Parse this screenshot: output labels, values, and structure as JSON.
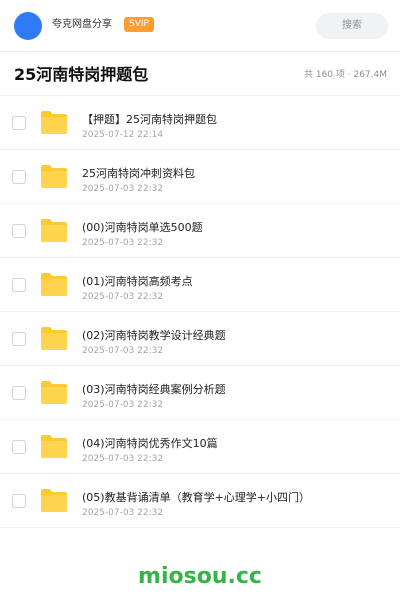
{
  "header": {
    "username": "夸克网盘分享",
    "badge": "SVIP",
    "search_label": "搜索"
  },
  "folder": {
    "title": "25河南特岗押题包",
    "meta": "共 160 项 · 267.4M"
  },
  "files": [
    {
      "name": "【押题】25河南特岗押题包",
      "date": "2025-07-12 22:14"
    },
    {
      "name": "25河南特岗冲刺资料包",
      "date": "2025-07-03 22:32"
    },
    {
      "name": "(00)河南特岗单选500题",
      "date": "2025-07-03 22:32"
    },
    {
      "name": "(01)河南特岗高频考点",
      "date": "2025-07-03 22:32"
    },
    {
      "name": "(02)河南特岗教学设计经典题",
      "date": "2025-07-03 22:32"
    },
    {
      "name": "(03)河南特岗经典案例分析题",
      "date": "2025-07-03 22:32"
    },
    {
      "name": "(04)河南特岗优秀作文10篇",
      "date": "2025-07-03 22:32"
    },
    {
      "name": "(05)教基背诵清单（教育学+心理学+小四门）",
      "date": "2025-07-03 22:32"
    }
  ],
  "watermark": "miosou.cc",
  "colors": {
    "accent": "#2f7bf6",
    "badge": "#ff9d2e",
    "folder": "#ffc933",
    "watermark": "#37b34a"
  },
  "icons": {
    "folder": "folder-icon",
    "checkbox": "checkbox-icon"
  }
}
